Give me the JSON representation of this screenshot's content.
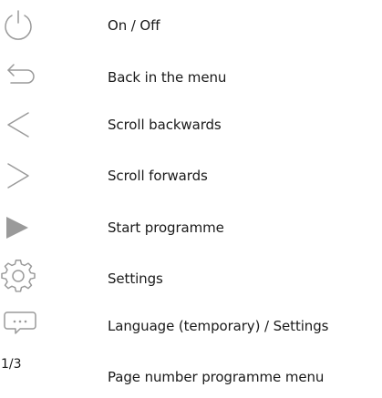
{
  "legend": {
    "items": [
      {
        "icon": "power-icon",
        "label": "On / Off"
      },
      {
        "icon": "back-arrow-icon",
        "label": "Back in the menu"
      },
      {
        "icon": "chevron-left-icon",
        "label": "Scroll backwards"
      },
      {
        "icon": "chevron-right-icon",
        "label": "Scroll forwards"
      },
      {
        "icon": "play-icon",
        "label": "Start programme"
      },
      {
        "icon": "gear-icon",
        "label": "Settings"
      },
      {
        "icon": "speech-bubble-icon",
        "label": "Language (temporary) / Settings"
      },
      {
        "page_number": "1/3",
        "label": "Page number programme menu"
      }
    ]
  },
  "colors": {
    "icon": "#9a9a9a",
    "text": "#1a1a1a"
  }
}
